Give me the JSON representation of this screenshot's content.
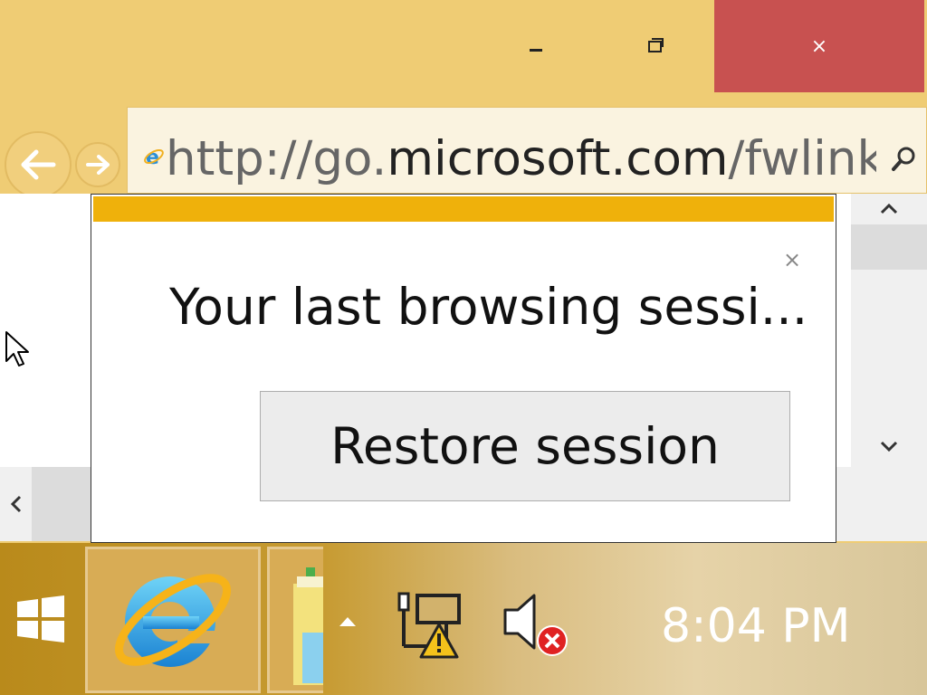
{
  "window": {
    "close_symbol": "×",
    "close_color": "#c85150"
  },
  "address_bar": {
    "url_prefix": "http://go.",
    "url_domain": "microsoft.com",
    "url_suffix": "/fwlink"
  },
  "dialog": {
    "message": "Your last browsing sessi...",
    "close_symbol": "×",
    "restore_label": "Restore session",
    "accent_color": "#efb10b"
  },
  "taskbar": {
    "clock": "8:04 PM"
  },
  "icons": {
    "titlebar": [
      "minimize-icon",
      "maximize-icon",
      "close-icon"
    ],
    "nav": [
      "back-arrow-icon",
      "forward-arrow-icon",
      "ie-favicon-icon",
      "search-icon"
    ],
    "page": [
      "scroll-up-icon",
      "scroll-down-icon",
      "scroll-left-icon",
      "mouse-pointer-icon"
    ],
    "taskbar": [
      "windows-logo-icon",
      "internet-explorer-icon",
      "file-explorer-icon",
      "tray-chevron-icon",
      "network-warning-icon",
      "volume-muted-icon"
    ]
  }
}
